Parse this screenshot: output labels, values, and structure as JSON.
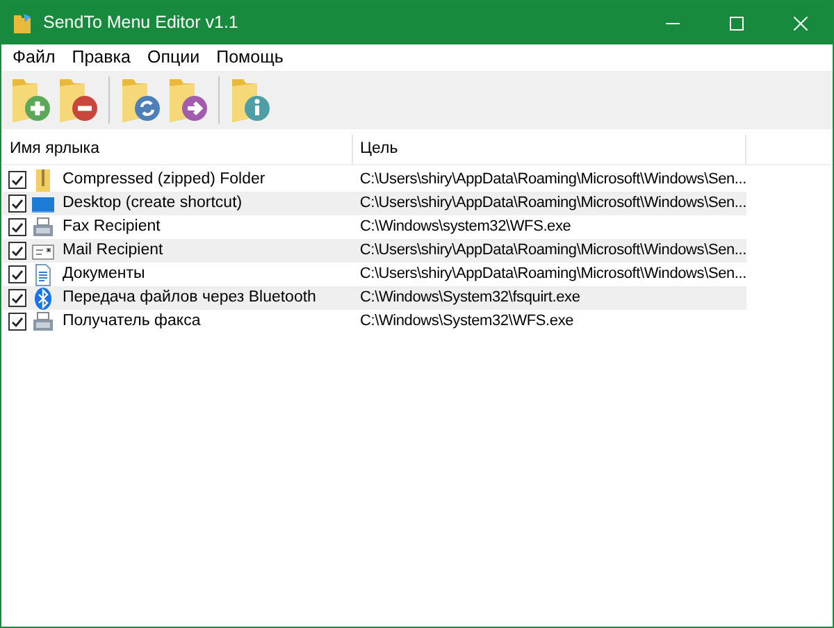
{
  "window": {
    "title": "SendTo Menu Editor v1.1"
  },
  "menu": [
    "Файл",
    "Правка",
    "Опции",
    "Помощь"
  ],
  "toolbar": [
    [
      {
        "kind": "add"
      },
      {
        "kind": "remove"
      }
    ],
    [
      {
        "kind": "refresh"
      },
      {
        "kind": "move"
      }
    ],
    [
      {
        "kind": "info"
      }
    ]
  ],
  "table": {
    "columns": [
      "Имя ярлыка",
      "Цель"
    ],
    "rows": [
      {
        "checked": true,
        "kind": "zip",
        "name": "Compressed (zipped) Folder",
        "target": "C:\\Users\\shiry\\AppData\\Roaming\\Microsoft\\Windows\\Sen..."
      },
      {
        "checked": true,
        "kind": "desktop",
        "name": "Desktop (create shortcut)",
        "target": "C:\\Users\\shiry\\AppData\\Roaming\\Microsoft\\Windows\\Sen..."
      },
      {
        "checked": true,
        "kind": "fax",
        "name": "Fax Recipient",
        "target": "C:\\Windows\\system32\\WFS.exe"
      },
      {
        "checked": true,
        "kind": "mail",
        "name": "Mail Recipient",
        "target": "C:\\Users\\shiry\\AppData\\Roaming\\Microsoft\\Windows\\Sen..."
      },
      {
        "checked": true,
        "kind": "document",
        "name": "Документы",
        "target": "C:\\Users\\shiry\\AppData\\Roaming\\Microsoft\\Windows\\Sen..."
      },
      {
        "checked": true,
        "kind": "bluetooth",
        "name": "Передача файлов через Bluetooth",
        "target": "C:\\Windows\\System32\\fsquirt.exe"
      },
      {
        "checked": true,
        "kind": "fax",
        "name": "Получатель факса",
        "target": "C:\\Windows\\System32\\WFS.exe"
      }
    ]
  }
}
